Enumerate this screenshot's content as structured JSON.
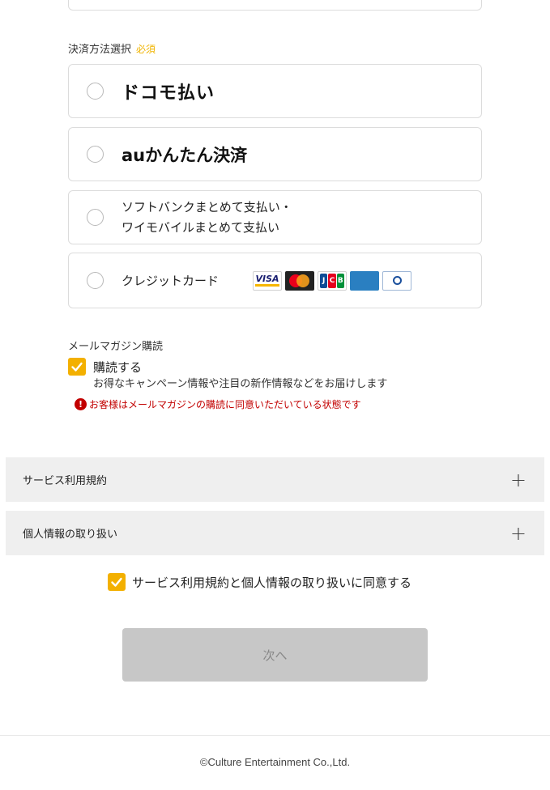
{
  "payment": {
    "section_label": "決済方法選択",
    "required_badge": "必須",
    "options": [
      {
        "label": "ドコモ払い"
      },
      {
        "label": "auかんたん決済"
      },
      {
        "label_line1": "ソフトバンクまとめて支払い・",
        "label_line2": "ワイモバイルまとめて支払い"
      },
      {
        "label": "クレジットカード"
      }
    ],
    "card_brands": {
      "visa": "VISA",
      "jcb": [
        "J",
        "C",
        "B"
      ],
      "icon_names": [
        "visa-logo-icon",
        "mastercard-logo-icon",
        "jcb-logo-icon",
        "amex-logo-icon",
        "diners-club-logo-icon"
      ]
    }
  },
  "mail_magazine": {
    "section_label": "メールマガジン購読",
    "checkbox_label": "購読する",
    "checked": true,
    "description": "お得なキャンペーン情報や注目の新作情報などをお届けします",
    "notice": "お客様はメールマガジンの購読に同意いただいている状態です",
    "notice_icon": "!"
  },
  "accordions": [
    {
      "label": "サービス利用規約",
      "icon": "+"
    },
    {
      "label": "個人情報の取り扱い",
      "icon": "+"
    }
  ],
  "agreement": {
    "label": "サービス利用規約と個人情報の取り扱いに同意する",
    "checked": true
  },
  "next_button": {
    "label": "次へ",
    "disabled": true
  },
  "footer": {
    "copyright": "©Culture Entertainment Co.,Ltd."
  },
  "colors": {
    "accent_check": "#f3b000",
    "required": "#f0b400",
    "notice": "#c20000",
    "button_disabled": "#c7c7c7"
  }
}
